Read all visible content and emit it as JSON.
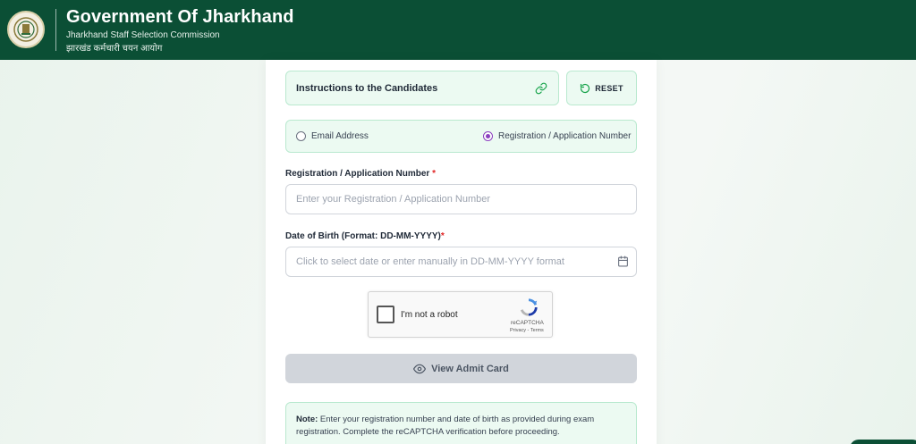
{
  "header": {
    "title": "Government Of Jharkhand",
    "subtitle_en": "Jharkhand Staff Selection Commission",
    "subtitle_hi": "झारखंड कर्मचारी चयन आयोग",
    "emblem_icon": "state-emblem-icon"
  },
  "toolbar": {
    "instructions_label": "Instructions to the Candidates",
    "reset_label": "RESET"
  },
  "login_mode": {
    "options": [
      {
        "label": "Email Address",
        "selected": false
      },
      {
        "label": "Registration / Application Number",
        "selected": true
      }
    ]
  },
  "form": {
    "reg_label": "Registration / Application Number",
    "reg_placeholder": "Enter your Registration / Application Number",
    "dob_label": "Date of Birth (Format: DD-MM-YYYY)",
    "dob_placeholder": "Click to select date or enter manually in DD-MM-YYYY format",
    "required_mark": "*"
  },
  "captcha": {
    "checkbox_label": "I'm not a robot",
    "brand": "reCAPTCHA",
    "links": "Privacy - Terms"
  },
  "submit": {
    "label": "View Admit Card"
  },
  "note": {
    "title": "Note:",
    "text": " Enter your registration number and date of birth as provided during exam registration. Complete the reCAPTCHA verification before proceeding."
  },
  "colors": {
    "header_bg": "#0b4f35",
    "accent_bg": "#ecfaf2",
    "accent_border": "#b9e9cf",
    "radio_selected": "#8b3fbf",
    "required": "#e02424"
  }
}
